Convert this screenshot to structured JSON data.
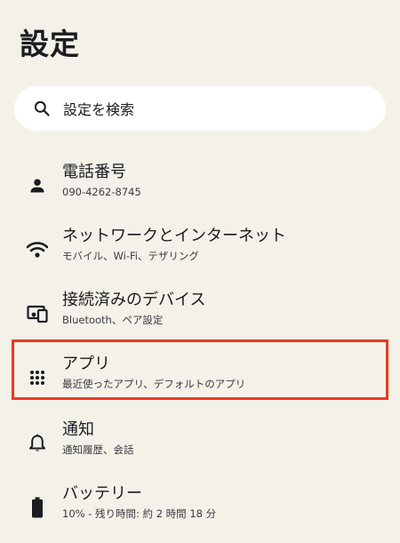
{
  "page": {
    "title": "設定"
  },
  "search": {
    "placeholder": "設定を検索",
    "icon": "search-icon"
  },
  "items": [
    {
      "title": "電話番号",
      "subtitle": "090-4262-8745",
      "icon": "person-icon"
    },
    {
      "title": "ネットワークとインターネット",
      "subtitle": "モバイル、Wi-Fi、テザリング",
      "icon": "wifi-icon"
    },
    {
      "title": "接続済みのデバイス",
      "subtitle": "Bluetooth、ペア設定",
      "icon": "connected-devices-icon"
    },
    {
      "title": "アプリ",
      "subtitle": "最近使ったアプリ、デフォルトのアプリ",
      "icon": "apps-grid-icon"
    },
    {
      "title": "通知",
      "subtitle": "通知履歴、会話",
      "icon": "bell-icon"
    },
    {
      "title": "バッテリー",
      "subtitle": "10% - 残り時間: 約 2 時間 18 分",
      "icon": "battery-icon"
    }
  ],
  "colors": {
    "background": "#f4f1e9",
    "highlight": "#ea3b1f"
  }
}
